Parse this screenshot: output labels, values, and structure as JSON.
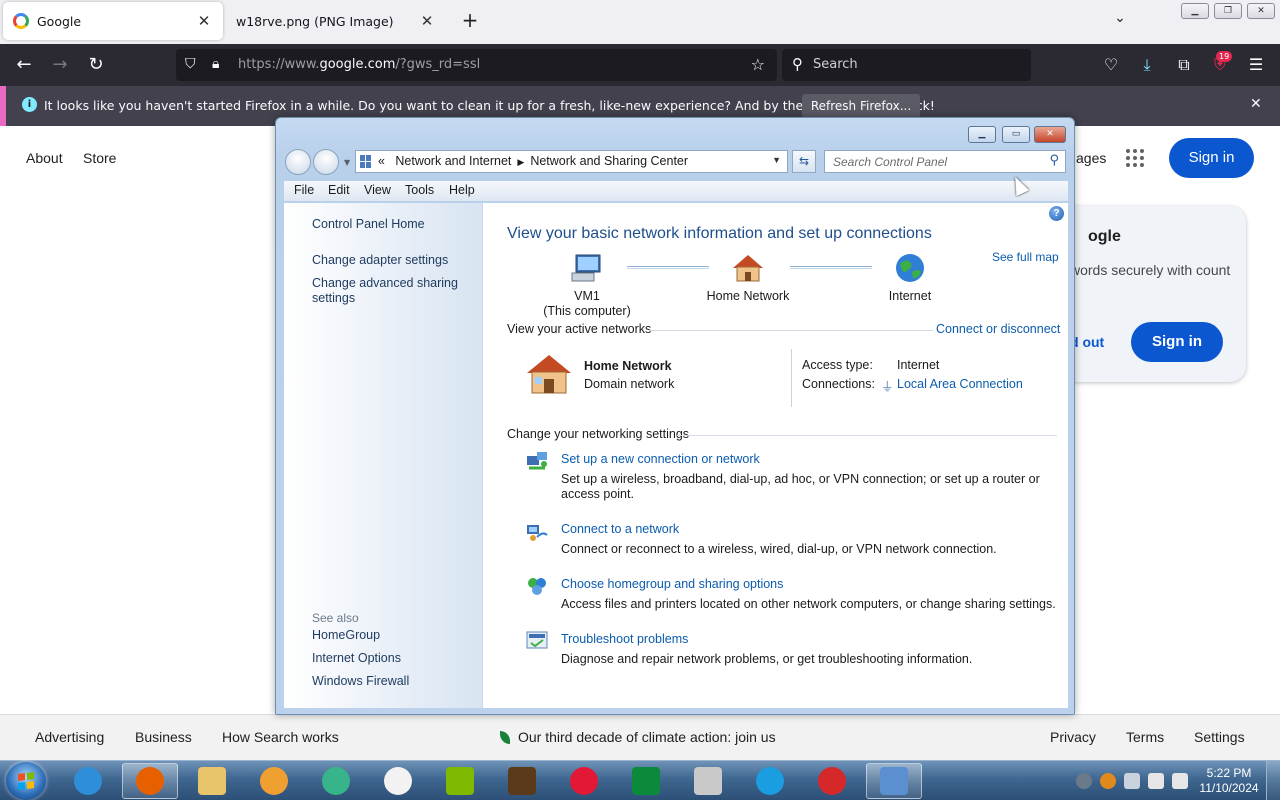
{
  "browser": {
    "tabs": [
      {
        "title": "Google",
        "active": true
      },
      {
        "title": "w18rve.png (PNG Image)",
        "active": false
      }
    ],
    "new_tab_label": "+",
    "url_prefix": "https://www.",
    "url_host": "google.com",
    "url_suffix": "/?gws_rd=ssl",
    "search_placeholder": "Search",
    "extensions_badge": "19",
    "notification": {
      "message": "It looks like you haven't started Firefox in a while. Do you want to clean it up for a fresh, like-new experience? And by the way, welcome back!",
      "button_label": "Refresh Firefox...",
      "accent_color": "#e76ac4"
    }
  },
  "google": {
    "top_links": [
      "About",
      "Store"
    ],
    "signin_label": "Sign in",
    "card": {
      "title_fragment": "ogle",
      "text_fragment": "words securely with count",
      "link_fragment": "d out",
      "signin_label": "Sign in"
    },
    "header_fragment": "ages",
    "footer": {
      "left": [
        "Advertising",
        "Business",
        "How Search works"
      ],
      "center": "Our third decade of climate action: join us",
      "right": [
        "Privacy",
        "Terms",
        "Settings"
      ]
    },
    "brand_blue": "#0b57d0"
  },
  "control_panel": {
    "breadcrumb_prefix": "«",
    "breadcrumbs": [
      "Network and Internet",
      "Network and Sharing Center"
    ],
    "search_placeholder": "Search Control Panel",
    "menu": [
      "File",
      "Edit",
      "View",
      "Tools",
      "Help"
    ],
    "left_pane": {
      "links": [
        "Control Panel Home",
        "Change adapter settings",
        "Change advanced sharing settings"
      ],
      "see_also_title": "See also",
      "see_also": [
        "HomeGroup",
        "Internet Options",
        "Windows Firewall"
      ]
    },
    "main": {
      "heading": "View your basic network information and set up connections",
      "see_full_map": "See full map",
      "map": [
        {
          "label": "VM1",
          "sublabel": "(This computer)",
          "icon": "computer-icon"
        },
        {
          "label": "Home Network",
          "sublabel": "",
          "icon": "house-icon"
        },
        {
          "label": "Internet",
          "sublabel": "",
          "icon": "globe-icon"
        }
      ],
      "active_networks_title": "View your active networks",
      "connect_or_disconnect": "Connect or disconnect",
      "network_name": "Home Network",
      "network_type": "Domain network",
      "access_type_label": "Access type:",
      "access_type_value": "Internet",
      "connections_label": "Connections:",
      "connections_value": "Local Area Connection",
      "change_settings_title": "Change your networking settings",
      "tasks": [
        {
          "title": "Set up a new connection or network",
          "desc": "Set up a wireless, broadband, dial-up, ad hoc, or VPN connection; or set up a router or access point.",
          "icon": "network-setup-icon"
        },
        {
          "title": "Connect to a network",
          "desc": "Connect or reconnect to a wireless, wired, dial-up, or VPN network connection.",
          "icon": "connect-network-icon"
        },
        {
          "title": "Choose homegroup and sharing options",
          "desc": "Access files and printers located on other network computers, or change sharing settings.",
          "icon": "homegroup-icon"
        },
        {
          "title": "Troubleshoot problems",
          "desc": "Diagnose and repair network problems, or get troubleshooting information.",
          "icon": "troubleshoot-icon"
        }
      ],
      "link_color": "#0b5cad"
    }
  },
  "taskbar": {
    "apps": [
      {
        "name": "internet-explorer",
        "color": "#2e8fd8"
      },
      {
        "name": "firefox",
        "color": "#e66000"
      },
      {
        "name": "file-explorer",
        "color": "#e8c46a"
      },
      {
        "name": "media-player",
        "color": "#f0a030"
      },
      {
        "name": "chat-app",
        "color": "#38b48b"
      },
      {
        "name": "youtube",
        "color": "#f2f2f2"
      },
      {
        "name": "microsoft",
        "color": "#7fba00"
      },
      {
        "name": "ups",
        "color": "#5a3a1b"
      },
      {
        "name": "bank-of-america",
        "color": "#e31837"
      },
      {
        "name": "store-bag",
        "color": "#0a8a3a"
      },
      {
        "name": "generic-app",
        "color": "#c9c9c9"
      },
      {
        "name": "edge",
        "color": "#1b9de2"
      },
      {
        "name": "angry-birds",
        "color": "#d62828"
      },
      {
        "name": "control-panel",
        "color": "#5b8fd0"
      }
    ],
    "time": "5:22 PM",
    "date": "11/10/2024"
  }
}
